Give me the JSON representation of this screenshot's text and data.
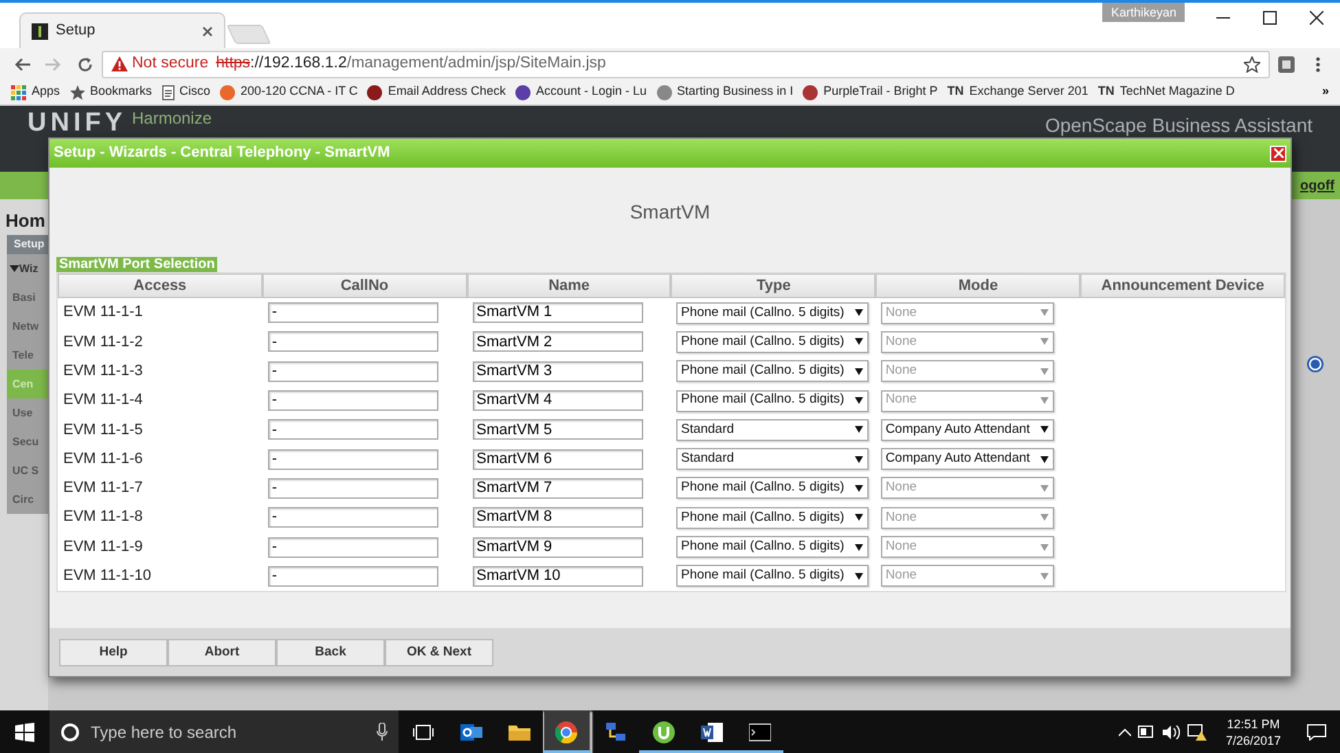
{
  "browser": {
    "tab_title": "Setup",
    "user": "Karthikeyan",
    "security": "Not secure",
    "url_scheme": "https",
    "url_host": "://192.168.1.2",
    "url_path": "/management/admin/jsp/SiteMain.jsp",
    "bookmarks": [
      {
        "kind": "apps",
        "label": "Apps"
      },
      {
        "kind": "star",
        "label": "Bookmarks"
      },
      {
        "kind": "page",
        "label": "Cisco"
      },
      {
        "kind": "site",
        "label": "200-120 CCNA - IT C"
      },
      {
        "kind": "site",
        "label": "Email Address Check"
      },
      {
        "kind": "site",
        "label": "Account - Login - Lu"
      },
      {
        "kind": "site",
        "label": "Starting Business in I"
      },
      {
        "kind": "site",
        "label": "PurpleTrail - Bright P"
      },
      {
        "kind": "text",
        "icon_text": "TN",
        "label": "Exchange Server 201"
      },
      {
        "kind": "text",
        "icon_text": "TN",
        "label": "TechNet Magazine D"
      }
    ],
    "more": "»"
  },
  "background_app": {
    "logo": "UNIFY",
    "logo_tagline": "Harmonize",
    "product": "OpenScape Business Assistant",
    "logoff": "ogoff",
    "home": "Hom",
    "sidebar": [
      {
        "label": "Setup",
        "kind": "header",
        "selected": false
      },
      {
        "label": "Wiz",
        "kind": "group",
        "selected": false
      },
      {
        "label": "Basi",
        "kind": "item",
        "selected": false
      },
      {
        "label": "Netw",
        "kind": "item",
        "selected": false
      },
      {
        "label": "Tele",
        "kind": "item",
        "selected": false
      },
      {
        "label": "Cen",
        "kind": "item",
        "selected": true
      },
      {
        "label": "Use",
        "kind": "item",
        "selected": false
      },
      {
        "label": "Secu",
        "kind": "item",
        "selected": false
      },
      {
        "label": "UC S",
        "kind": "item",
        "selected": false
      },
      {
        "label": "Circ",
        "kind": "item",
        "selected": false
      }
    ]
  },
  "dialog": {
    "title": "Setup - Wizards - Central Telephony - SmartVM",
    "heading": "SmartVM",
    "section": "SmartVM Port Selection",
    "columns": [
      "Access",
      "CallNo",
      "Name",
      "Type",
      "Mode",
      "Announcement Device"
    ],
    "rows": [
      {
        "access": "EVM 11-1-1",
        "callno": "-",
        "name": "SmartVM 1",
        "type": "Phone mail (Callno. 5 digits)",
        "mode": "None",
        "mode_disabled": true
      },
      {
        "access": "EVM 11-1-2",
        "callno": "-",
        "name": "SmartVM 2",
        "type": "Phone mail (Callno. 5 digits)",
        "mode": "None",
        "mode_disabled": true
      },
      {
        "access": "EVM 11-1-3",
        "callno": "-",
        "name": "SmartVM 3",
        "type": "Phone mail (Callno. 5 digits)",
        "mode": "None",
        "mode_disabled": true
      },
      {
        "access": "EVM 11-1-4",
        "callno": "-",
        "name": "SmartVM 4",
        "type": "Phone mail (Callno. 5 digits)",
        "mode": "None",
        "mode_disabled": true
      },
      {
        "access": "EVM 11-1-5",
        "callno": "-",
        "name": "SmartVM 5",
        "type": "Standard",
        "mode": "Company Auto Attendant",
        "mode_disabled": false
      },
      {
        "access": "EVM 11-1-6",
        "callno": "-",
        "name": "SmartVM 6",
        "type": "Standard",
        "mode": "Company Auto Attendant",
        "mode_disabled": false
      },
      {
        "access": "EVM 11-1-7",
        "callno": "-",
        "name": "SmartVM 7",
        "type": "Phone mail (Callno. 5 digits)",
        "mode": "None",
        "mode_disabled": true
      },
      {
        "access": "EVM 11-1-8",
        "callno": "-",
        "name": "SmartVM 8",
        "type": "Phone mail (Callno. 5 digits)",
        "mode": "None",
        "mode_disabled": true
      },
      {
        "access": "EVM 11-1-9",
        "callno": "-",
        "name": "SmartVM 9",
        "type": "Phone mail (Callno. 5 digits)",
        "mode": "None",
        "mode_disabled": true
      },
      {
        "access": "EVM 11-1-10",
        "callno": "-",
        "name": "SmartVM 10",
        "type": "Phone mail (Callno. 5 digits)",
        "mode": "None",
        "mode_disabled": true
      }
    ],
    "buttons": [
      "Help",
      "Abort",
      "Back",
      "OK & Next"
    ]
  },
  "taskbar": {
    "search_placeholder": "Type here to search",
    "apps": [
      {
        "kind": "mail",
        "running": false,
        "selected": false
      },
      {
        "kind": "folder",
        "running": false,
        "selected": false
      },
      {
        "kind": "browser",
        "running": true,
        "selected": true
      },
      {
        "kind": "network",
        "running": false,
        "selected": false
      },
      {
        "kind": "torrent",
        "running": true,
        "selected": false
      },
      {
        "kind": "document",
        "running": true,
        "selected": false
      },
      {
        "kind": "terminal",
        "running": true,
        "selected": false
      }
    ],
    "time": "12:51 PM",
    "date": "7/26/2017"
  }
}
